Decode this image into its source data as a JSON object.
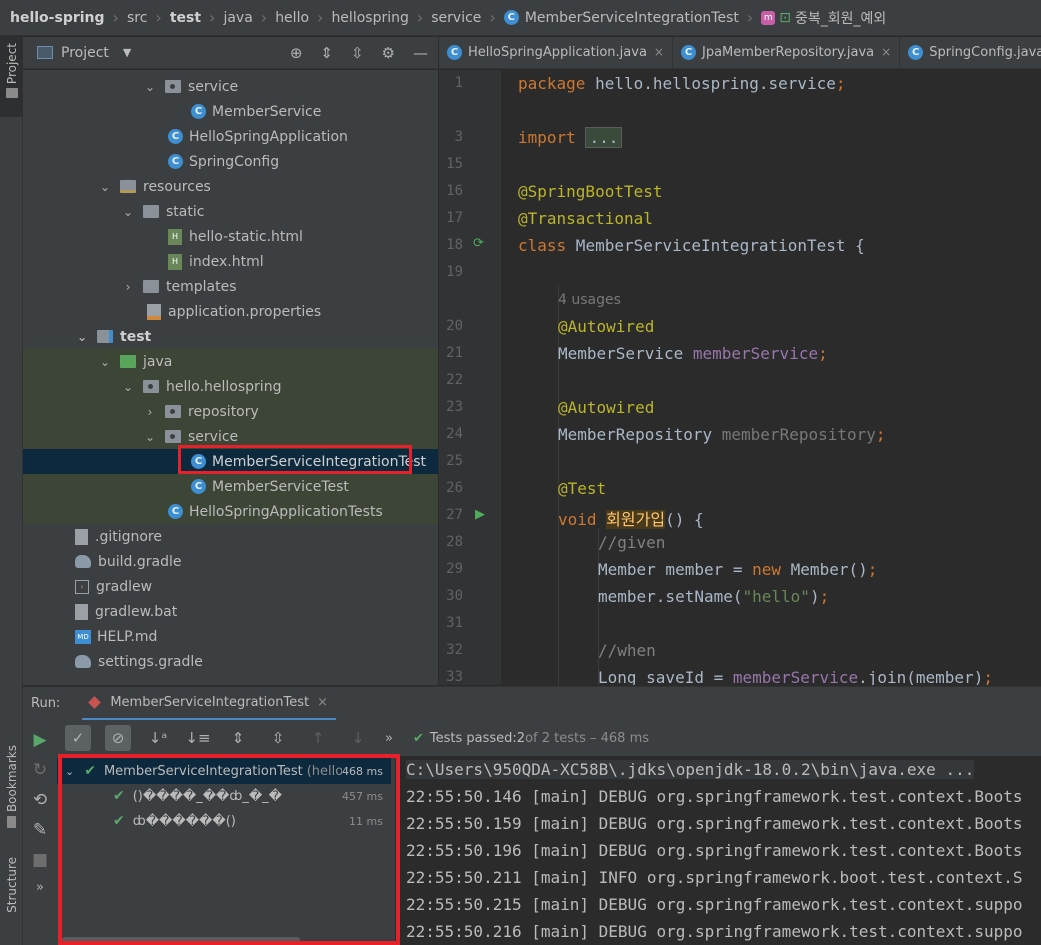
{
  "breadcrumb": {
    "items": [
      "hello-spring",
      "src",
      "test",
      "java",
      "hello",
      "hellospring",
      "service",
      "MemberServiceIntegrationTest",
      "중복_회원_예외"
    ]
  },
  "side_tabs": {
    "project": "Project",
    "bookmarks": "Bookmarks",
    "structure": "Structure"
  },
  "project": {
    "title": "Project",
    "tree": [
      {
        "label": "service",
        "kind": "package",
        "arrow": "⌄"
      },
      {
        "label": "MemberService",
        "kind": "class"
      },
      {
        "label": "HelloSpringApplication",
        "kind": "class-spring"
      },
      {
        "label": "SpringConfig",
        "kind": "class"
      },
      {
        "label": "resources",
        "kind": "res-folder",
        "arrow": "⌄"
      },
      {
        "label": "static",
        "kind": "folder",
        "arrow": "⌄"
      },
      {
        "label": "hello-static.html",
        "kind": "html"
      },
      {
        "label": "index.html",
        "kind": "html"
      },
      {
        "label": "templates",
        "kind": "folder",
        "arrow": "›"
      },
      {
        "label": "application.properties",
        "kind": "properties"
      },
      {
        "label": "test",
        "kind": "test-folder",
        "arrow": "⌄"
      },
      {
        "label": "java",
        "kind": "green-folder",
        "arrow": "⌄"
      },
      {
        "label": "hello.hellospring",
        "kind": "package",
        "arrow": "⌄"
      },
      {
        "label": "repository",
        "kind": "package",
        "arrow": "›"
      },
      {
        "label": "service",
        "kind": "package",
        "arrow": "⌄"
      },
      {
        "label": "MemberServiceIntegrationTest",
        "kind": "test-class"
      },
      {
        "label": "MemberServiceTest",
        "kind": "test-class"
      },
      {
        "label": "HelloSpringApplicationTests",
        "kind": "test-class"
      },
      {
        "label": ".gitignore",
        "kind": "plain"
      },
      {
        "label": "build.gradle",
        "kind": "gradle"
      },
      {
        "label": "gradlew",
        "kind": "shell"
      },
      {
        "label": "gradlew.bat",
        "kind": "plain"
      },
      {
        "label": "HELP.md",
        "kind": "md"
      },
      {
        "label": "settings.gradle",
        "kind": "gradle"
      }
    ]
  },
  "editor": {
    "tabs": [
      "HelloSpringApplication.java",
      "JpaMemberRepository.java",
      "SpringConfig.java"
    ],
    "line_numbers": [
      "1",
      "3",
      "15",
      "16",
      "17",
      "18",
      "19",
      "20",
      "21",
      "22",
      "23",
      "24",
      "25",
      "26",
      "27",
      "28",
      "29",
      "30",
      "31",
      "32",
      "33"
    ],
    "code": {
      "l1_kw": "package",
      "l1_rest": " hello.hellospring.service",
      "l1_semi": ";",
      "l3_kw": "import",
      "l3_fold": "...",
      "l16": "@SpringBootTest",
      "l17": "@Transactional",
      "l18_kw": "class",
      "l18_rest": " MemberServiceIntegrationTest {",
      "usages": "4 usages",
      "l20": "@Autowired",
      "l21_type": "MemberService ",
      "l21_field": "memberService",
      "l21_semi": ";",
      "l23": "@Autowired",
      "l24_type": "MemberRepository ",
      "l24_field": "memberRepository",
      "l24_semi": ";",
      "l26": "@Test",
      "l27_kw": "void",
      "l27_sp": " ",
      "l27_name": "회원가입",
      "l27_rest": "() {",
      "l28": "//given",
      "l29_a": "Member member = ",
      "l29_kw": "new",
      "l29_b": " Member()",
      "l29_semi": ";",
      "l30_a": "member.setName(",
      "l30_str": "\"hello\"",
      "l30_b": ")",
      "l30_semi": ";",
      "l32": "//when",
      "l33_a": "Long saveId = ",
      "l33_field": "memberService",
      "l33_b": ".join(member)",
      "l33_semi": ";"
    }
  },
  "run": {
    "label": "Run:",
    "tab_title": "MemberServiceIntegrationTest",
    "status_prefix": "Tests passed: ",
    "passed": "2",
    "status_suffix": " of 2 tests – 468 ms",
    "results": [
      {
        "name": "MemberServiceIntegrationTest",
        "suffix": "(hello.",
        "duration": "468 ms"
      },
      {
        "name": "()����_��ȸ_�_�",
        "duration": "457 ms"
      },
      {
        "name": "ȸ������()",
        "duration": "11 ms"
      }
    ],
    "console": [
      "C:\\Users\\950QDA-XC58B\\.jdks\\openjdk-18.0.2\\bin\\java.exe ...",
      "22:55:50.146 [main] DEBUG org.springframework.test.context.Boots",
      "22:55:50.159 [main] DEBUG org.springframework.test.context.Boots",
      "22:55:50.196 [main] DEBUG org.springframework.test.context.Boots",
      "22:55:50.211 [main] INFO org.springframework.boot.test.context.S",
      "22:55:50.215 [main] DEBUG org.springframework.test.context.suppo",
      "22:55:50.216 [main] DEBUG org.springframework.test.context.suppo"
    ]
  },
  "colors": {
    "keyword": "#cc7832",
    "annotation": "#bbb529",
    "field": "#9876aa",
    "string": "#6a8759",
    "comment": "#808080",
    "pass_green": "#59a869",
    "highlight_red": "#e8202a",
    "selection": "#0d293e"
  }
}
